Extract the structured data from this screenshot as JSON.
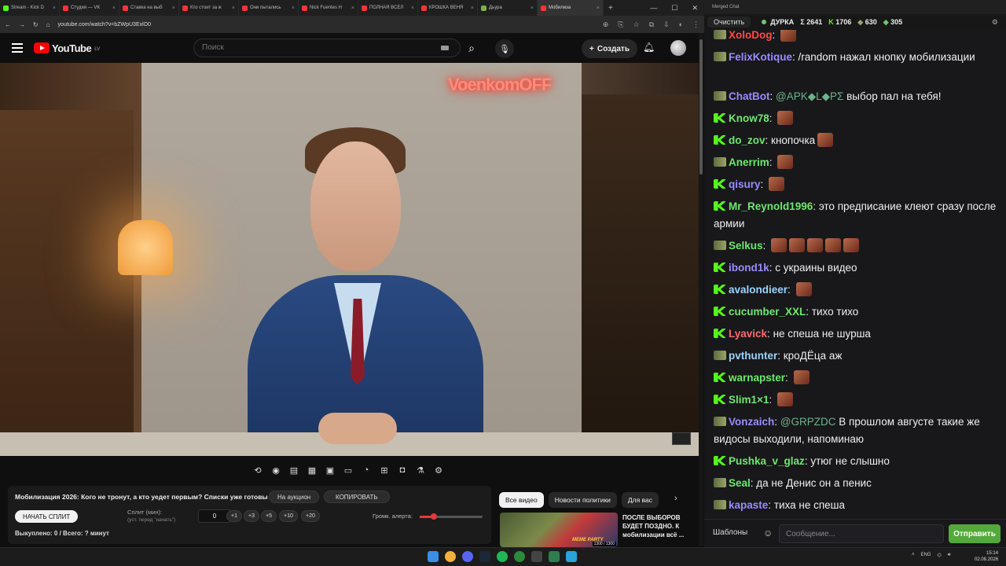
{
  "browser": {
    "tabs": [
      {
        "label": "Stream - Kick D",
        "color": "#53fc18"
      },
      {
        "label": "Студия — VK",
        "color": "#ff3333"
      },
      {
        "label": "Ставка на выб",
        "color": "#ff3333"
      },
      {
        "label": "Кто стоит за ж",
        "color": "#ff3333"
      },
      {
        "label": "Они пытались",
        "color": "#ff3333"
      },
      {
        "label": "Nick Fuentes H",
        "color": "#ff3333"
      },
      {
        "label": "ПОЛНАЯ ВСЕЛ",
        "color": "#ff3333"
      },
      {
        "label": "КРОШКА ВЕНЯ",
        "color": "#ff3333"
      },
      {
        "label": "Дьура",
        "color": "#7ab04a"
      },
      {
        "label": "Мобилиза",
        "color": "#ff3333"
      }
    ],
    "url": "youtube.com/watch?v=bZWpU3ExlO0",
    "win_min": "—",
    "win_max": "☐",
    "win_close": "✕"
  },
  "youtube": {
    "logo_text": "YouTube",
    "region": "LV",
    "search_placeholder": "Поиск",
    "create_label": "Создать",
    "video_neon": "VoenkomOFF"
  },
  "panel": {
    "title": "Мобилизация 2026: Кого не тронут, а кто уедет первым? Списки уже готовы",
    "auction_label": "На аукцион",
    "copy_label": "КОПИРОВАТЬ",
    "start_split_label": "НАЧАТЬ СПЛИТ",
    "split_label": "Сплит (мин):",
    "split_hint": "(уст. перед \"начать\")",
    "split_value": "0",
    "increments": [
      "+1",
      "+3",
      "+5",
      "+10",
      "+20"
    ],
    "alert_volume_label": "Громк. алерта:",
    "alert_volume_level": 0.22,
    "footer": "Выкуплено: 0 / Всего: ? минут"
  },
  "related": {
    "chips": [
      "Все видео",
      "Новости политики",
      "Для вас"
    ],
    "video_title": "ПОСЛЕ ВЫБОРОВ БУДЕТ ПОЗДНО. К мобилизации всё ...",
    "thumb_badge": "MEME PARTY",
    "thumb_time": "1300 / 1300"
  },
  "chat": {
    "window_title": "Merged Chat",
    "clear_label": "Очистить",
    "channel": "ДУРКА",
    "stats": [
      {
        "icon": "sigma",
        "value": "Σ 2641"
      },
      {
        "icon": "kick-icon",
        "value": "1706"
      },
      {
        "icon": "soldier-icon",
        "value": "630"
      },
      {
        "icon": "trovo-icon",
        "value": "305"
      }
    ],
    "messages": [
      {
        "user": "XoloDog",
        "color": "#ff4a4a",
        "badge": "s",
        "text": "",
        "emotes": 1
      },
      {
        "user": "FelixKotique",
        "color": "#9a8cff",
        "badge": "s",
        "text": "/random нажал кнопку мобилизации",
        "emotes": 0
      },
      {
        "user": "ChatBot",
        "color": "#9a8cff",
        "badge": "s",
        "mention": "@ΑΡΚ◆L◆ΡΣ",
        "text": " выбор пал на тебя!",
        "emotes": 0
      },
      {
        "user": "Know78",
        "color": "#6ee86e",
        "badge": "k",
        "text": "",
        "emotes": 1
      },
      {
        "user": "do_zov",
        "color": "#6ee86e",
        "badge": "k",
        "text": "кнопочка",
        "emotes": 1
      },
      {
        "user": "Anerrim",
        "color": "#6ee86e",
        "badge": "s",
        "text": "",
        "emotes": 1
      },
      {
        "user": "qisury",
        "color": "#9a8cff",
        "badge": "k",
        "text": "",
        "emotes": 1
      },
      {
        "user": "Mr_Reynold1996",
        "color": "#6ee86e",
        "badge": "k",
        "text": "это предписание клеют сразу после армии",
        "emotes": 0
      },
      {
        "user": "Selkus",
        "color": "#6ee86e",
        "badge": "s",
        "text": "",
        "emotes": 5
      },
      {
        "user": "ibond1k",
        "color": "#9a8cff",
        "badge": "k",
        "text": "с украины видео",
        "emotes": 0
      },
      {
        "user": "avalondieer",
        "color": "#9ad4ff",
        "badge": "k",
        "text": "",
        "emotes": 1
      },
      {
        "user": "cucumber_XXL",
        "color": "#6ee86e",
        "badge": "k",
        "text": "тихо тихо",
        "emotes": 0
      },
      {
        "user": "Lyavick",
        "color": "#ff6a6a",
        "badge": "k",
        "text": "не спеша не шурша",
        "emotes": 0
      },
      {
        "user": "pvthunter",
        "color": "#9ad4ff",
        "badge": "s",
        "text": "кроДЁца аж",
        "emotes": 0
      },
      {
        "user": "warnapster",
        "color": "#6ee86e",
        "badge": "k",
        "text": "",
        "emotes": 1
      },
      {
        "user": "Slim1×1",
        "color": "#6ee86e",
        "badge": "k",
        "text": "",
        "emotes": 1
      },
      {
        "user": "Vonzaich",
        "color": "#9a8cff",
        "badge": "s",
        "mention": "@GRPZDC",
        "text": " В прошлом августе такие же видосы выходили, напоминаю",
        "emotes": 0
      },
      {
        "user": "Pushka_v_glaz",
        "color": "#6ee86e",
        "badge": "k",
        "text": "утюг не слышно",
        "emotes": 0
      },
      {
        "user": "Seal",
        "color": "#6ee86e",
        "badge": "s",
        "text": "да не Денис он а пенис",
        "emotes": 0
      },
      {
        "user": "kapaste",
        "color": "#9a8cff",
        "badge": "s",
        "text": "тиха не спеша",
        "emotes": 0
      }
    ],
    "templates_label": "Шаблоны",
    "input_placeholder": "Сообщение...",
    "send_label": "Отправить"
  },
  "taskbar": {
    "lang": "ENG",
    "time": "15:14",
    "date": "02.08.2026"
  }
}
